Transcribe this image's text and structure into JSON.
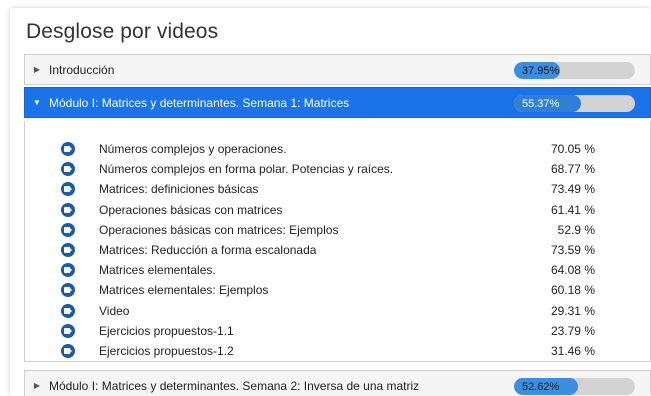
{
  "page": {
    "title": "Desglose por videos"
  },
  "sections": [
    {
      "label": "Introducción",
      "progress_text": "37.95%",
      "progress": 0.3795,
      "expanded": false
    },
    {
      "label": "Módulo I: Matrices y determinantes. Semana 1: Matrices",
      "progress_text": "55.37%",
      "progress": 0.5537,
      "expanded": true
    },
    {
      "label": "Módulo I: Matrices y determinantes. Semana 2: Inversa de una matriz",
      "progress_text": "52.62%",
      "progress": 0.5262,
      "expanded": false
    }
  ],
  "videos": [
    {
      "name": "Números complejos y operaciones.",
      "pct": "70.05 %",
      "icon": "video-icon"
    },
    {
      "name": "Números complejos en forma polar. Potencias y raíces.",
      "pct": "68.77 %",
      "icon": "video-icon"
    },
    {
      "name": "Matrices: definiciones básicas",
      "pct": "73.49 %",
      "icon": "video-icon"
    },
    {
      "name": "Operaciones básicas con matrices",
      "pct": "61.41 %",
      "icon": "video-icon"
    },
    {
      "name": "Operaciones básicas con matrices: Ejemplos",
      "pct": "52.9 %",
      "icon": "video-icon"
    },
    {
      "name": "Matrices: Reducción a forma escalonada",
      "pct": "73.59 %",
      "icon": "video-icon"
    },
    {
      "name": "Matrices elementales.",
      "pct": "64.08 %",
      "icon": "video-icon"
    },
    {
      "name": "Matrices elementales: Ejemplos",
      "pct": "60.18 %",
      "icon": "video-icon"
    },
    {
      "name": "Video",
      "pct": "29.31 %",
      "icon": "video-icon"
    },
    {
      "name": "Ejercicios propuestos-1.1",
      "pct": "23.79 %",
      "icon": "video-icon"
    },
    {
      "name": "Ejercicios propuestos-1.2",
      "pct": "31.46 %",
      "icon": "video-icon"
    }
  ],
  "colors": {
    "active_header": "#1a73e8",
    "progress_fill": "#3b8ee0",
    "progress_track": "#d3d3d3",
    "video_icon": "#1f5aa6"
  }
}
